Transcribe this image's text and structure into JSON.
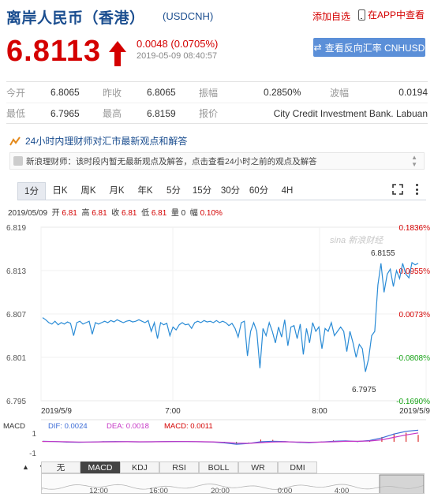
{
  "header": {
    "title": "离岸人民币（香港）",
    "code": "(USDCNH)",
    "add_watchlist": "添加自选",
    "view_in_app": "在APP中查看"
  },
  "quote": {
    "price": "6.8113",
    "change": "0.0048 (0.0705%)",
    "timestamp": "2019-05-09 08:40:57",
    "reverse_button": "查看反向汇率 CNHUSD"
  },
  "stats": {
    "open_label": "今开",
    "open_value": "6.8065",
    "prev_close_label": "昨收",
    "prev_close_value": "6.8065",
    "amplitude_label": "振幅",
    "amplitude_value": "0.2850%",
    "swing_label": "波幅",
    "swing_value": "0.0194",
    "low_label": "最低",
    "low_value": "6.7965",
    "high_label": "最高",
    "high_value": "6.8159",
    "quote_label": "报价",
    "quote_value": "City Credit Investment Bank. Labuan"
  },
  "advisor": {
    "title": "24小时内理财师对汇市最新观点和解答",
    "message": "新浪理财师：该时段内暂无最新观点及解答，点击查看24小时之前的观点及解答"
  },
  "chart_tabs": [
    "1分",
    "日K",
    "周K",
    "月K",
    "年K",
    "5分",
    "15分",
    "30分",
    "60分",
    "4H"
  ],
  "ohlc": {
    "date": "2019/05/09",
    "open_label": "开",
    "open": "6.81",
    "high_label": "高",
    "high": "6.81",
    "close_label": "收",
    "close": "6.81",
    "low_label": "低",
    "low": "6.81",
    "volume_label": "量",
    "volume": "0",
    "range_label": "幅",
    "range": "0.10%"
  },
  "watermark": "sina 新浪财经",
  "colors": {
    "up": "#d40000",
    "down": "#17a317",
    "line": "#2b8cd6",
    "brand_blue": "#1a4d8f",
    "button_blue": "#5b8fd8"
  },
  "chart_data": {
    "type": "line",
    "y_ticks": [
      "6.819",
      "6.813",
      "6.807",
      "6.801",
      "6.795"
    ],
    "ylim": [
      6.795,
      6.819
    ],
    "pct_ticks": [
      {
        "label": "0.1836%",
        "value": 0.1836,
        "color": "#d40000"
      },
      {
        "label": "0.0955%",
        "value": 0.0955,
        "color": "#d40000"
      },
      {
        "label": "0.0073%",
        "value": 0.0073,
        "color": "#d40000"
      },
      {
        "label": "-0.0808%",
        "value": -0.0808,
        "color": "#17a317"
      },
      {
        "label": "-0.1690%",
        "value": -0.169,
        "color": "#17a317"
      }
    ],
    "x_labels": [
      "2019/5/9",
      "7:00",
      "8:00",
      "2019/5/9"
    ],
    "annotations": [
      {
        "label": "6.8155",
        "value": 6.8155
      },
      {
        "label": "6.7975",
        "value": 6.7975
      }
    ],
    "series": [
      {
        "values": [
          6.8065,
          6.8062,
          6.8058,
          6.8056,
          6.806,
          6.8055,
          6.8058,
          6.8056,
          6.8059,
          6.8057,
          6.804,
          6.8058,
          6.806,
          6.8056,
          6.8058,
          6.806,
          6.8042,
          6.8058,
          6.8056,
          6.8058,
          6.806,
          6.8058,
          6.8061,
          6.8059,
          6.8062,
          6.806,
          6.8058,
          6.806,
          6.8061,
          6.8059,
          6.806,
          6.8062,
          6.806,
          6.8058,
          6.8061,
          6.8046,
          6.8058,
          6.8036,
          6.8058,
          6.8055,
          6.8057,
          6.804,
          6.8052,
          6.8048,
          6.8055,
          6.8058,
          6.8055,
          6.8056,
          6.805,
          6.8058,
          6.806,
          6.8058,
          6.8061,
          6.8059,
          6.806,
          6.8058,
          6.8061,
          6.8058,
          6.806,
          6.8058,
          6.8054,
          6.8057,
          6.805,
          6.8038,
          6.8058,
          6.806,
          6.8012,
          6.8046,
          6.8058,
          6.8046,
          6.7995,
          6.805,
          6.804,
          6.8058,
          6.8046,
          6.803,
          6.8052,
          6.8038,
          6.8062,
          6.8026,
          6.8052,
          6.8054,
          6.8036,
          6.8056,
          6.8014,
          6.805,
          6.803,
          6.8058,
          6.8046,
          6.8052,
          6.8022,
          6.805,
          6.8046,
          6.8058,
          6.804,
          6.8046,
          6.8052,
          6.8046,
          6.8018,
          6.8046,
          6.803,
          6.801,
          6.8028,
          6.8022,
          6.799,
          6.8008,
          6.804,
          6.8046,
          6.811,
          6.814,
          6.81,
          6.8125,
          6.8132,
          6.8108,
          6.813,
          6.8119,
          6.814,
          6.8125,
          6.812,
          6.8141,
          6.8138,
          6.814
        ]
      }
    ],
    "macd": {
      "label": "MACD",
      "dif": "DIF: 0.0024",
      "dea": "DEA: 0.0018",
      "macd": "MACD: 0.0011",
      "y_ticks": [
        "1",
        "-1"
      ],
      "dif_values": [
        0.05,
        0.02,
        -0.03,
        -0.05,
        -0.02,
        0.01,
        0.02,
        0.01,
        -0.01,
        0.0,
        0.02,
        0.03,
        0.02,
        0.0,
        -0.02,
        -0.1,
        -0.22,
        -0.15,
        0.0,
        0.05,
        0.02,
        -0.05,
        -0.08,
        -0.02,
        0.05,
        0.08,
        0.03,
        0.12,
        0.35,
        0.7,
        0.95,
        1.05
      ],
      "dea_values": [
        0.03,
        0.02,
        0.0,
        -0.02,
        -0.02,
        -0.01,
        0.0,
        0.01,
        0.0,
        0.0,
        0.01,
        0.02,
        0.02,
        0.01,
        -0.01,
        -0.05,
        -0.12,
        -0.14,
        -0.08,
        -0.02,
        0.0,
        -0.02,
        -0.04,
        -0.03,
        0.0,
        0.04,
        0.04,
        0.07,
        0.18,
        0.4,
        0.62,
        0.8
      ]
    }
  },
  "indicator_tabs": [
    "无",
    "MACD",
    "KDJ",
    "RSI",
    "BOLL",
    "WR",
    "DMI"
  ],
  "timeline_labels": [
    "12:00",
    "16:00",
    "20:00",
    "0:00",
    "4:00"
  ]
}
